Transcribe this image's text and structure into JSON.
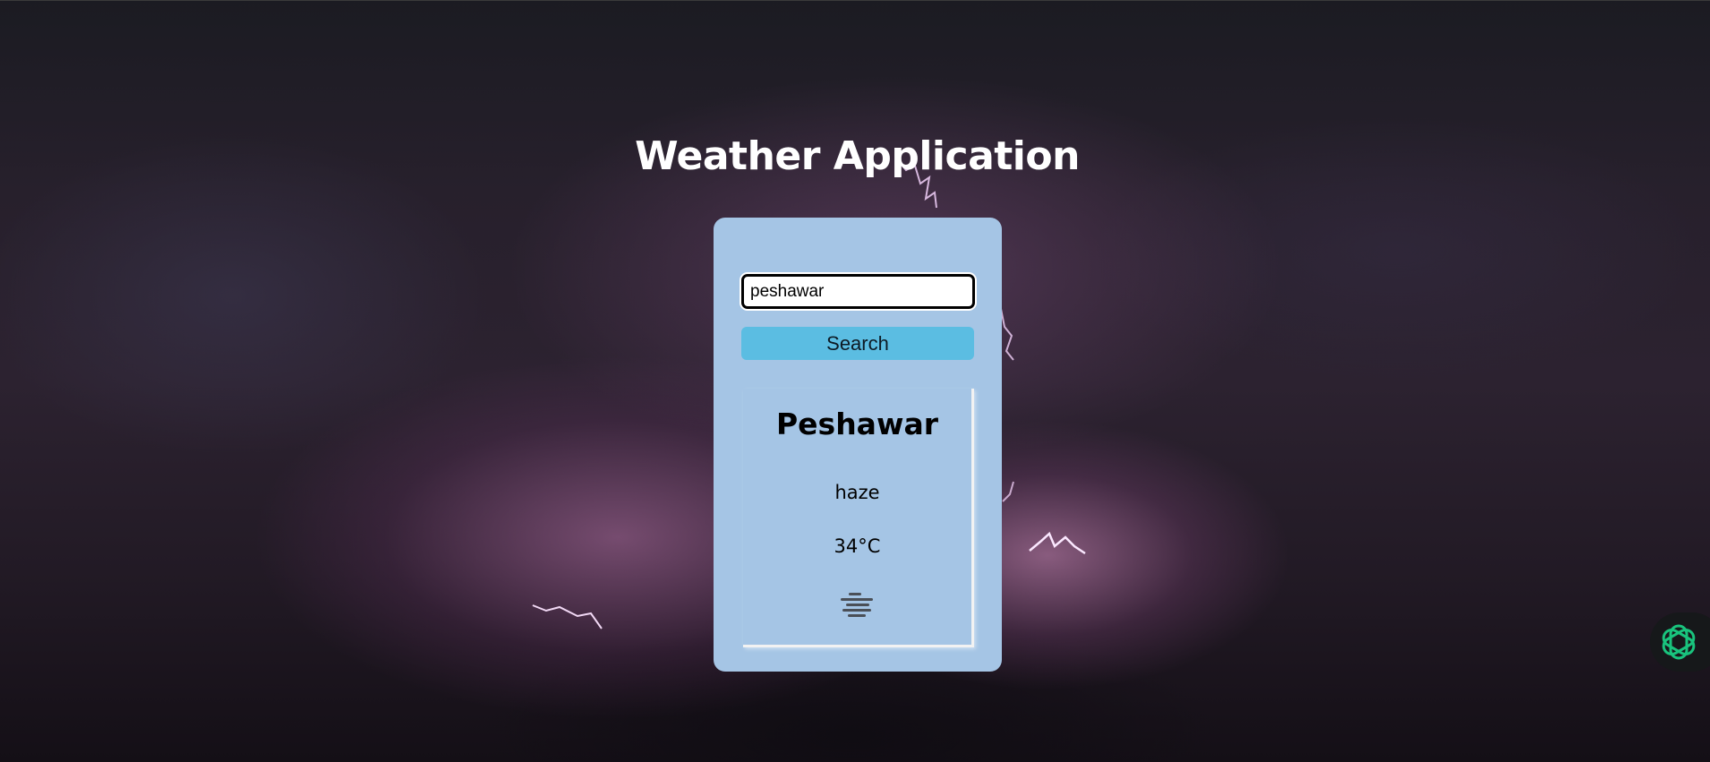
{
  "page": {
    "title": "Weather Application"
  },
  "search": {
    "value": "peshawar",
    "button_label": "Search"
  },
  "result": {
    "city": "Peshawar",
    "condition": "haze",
    "temperature": "34°C",
    "icon": "haze-icon"
  },
  "assistant": {
    "icon": "openai-logo-icon"
  },
  "colors": {
    "card_background": "#a5c5e5",
    "button_background": "#5bbde2",
    "assistant_icon": "#19c37d"
  }
}
